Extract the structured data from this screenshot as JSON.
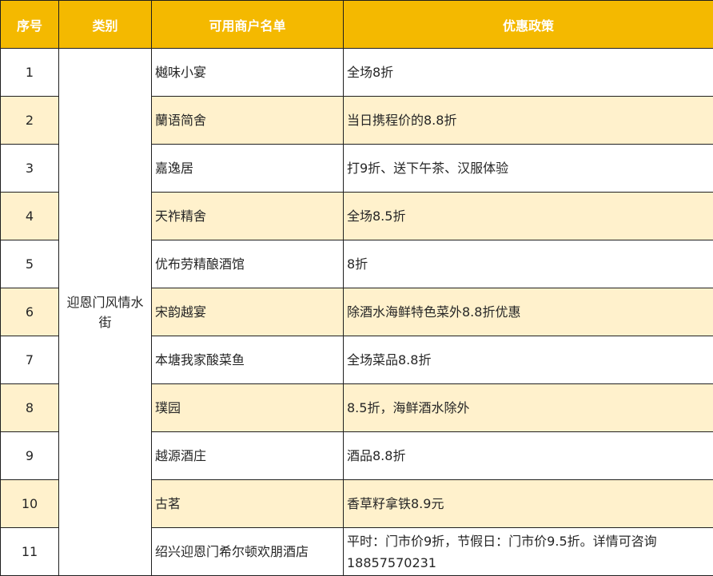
{
  "colors": {
    "header_bg": "#f4b900",
    "header_text": "#ffffff",
    "alt_row_bg": "#fff1cc",
    "row_bg": "#ffffff",
    "border": "#1f1f1f"
  },
  "table": {
    "headers": [
      "序号",
      "类别",
      "可用商户名单",
      "优惠政策"
    ],
    "category": "迎恩门风情水街",
    "rows": [
      {
        "no": "1",
        "merchant": "樾味小宴",
        "policy": "全场8折"
      },
      {
        "no": "2",
        "merchant": "蘭语简舍",
        "policy": "当日携程价的8.8折"
      },
      {
        "no": "3",
        "merchant": "嘉逸居",
        "policy": "打9折、送下午茶、汉服体验"
      },
      {
        "no": "4",
        "merchant": "天祚精舍",
        "policy": "全场8.5折"
      },
      {
        "no": "5",
        "merchant": "优布劳精酿酒馆",
        "policy": "8折"
      },
      {
        "no": "6",
        "merchant": "宋韵越宴",
        "policy": "除酒水海鲜特色菜外8.8折优惠"
      },
      {
        "no": "7",
        "merchant": "本塘我家酸菜鱼",
        "policy": "全场菜品8.8折"
      },
      {
        "no": "8",
        "merchant": "璞园",
        "policy": "8.5折，海鲜酒水除外"
      },
      {
        "no": "9",
        "merchant": "越源酒庄",
        "policy": "酒品8.8折"
      },
      {
        "no": "10",
        "merchant": "古茗",
        "policy": "香草籽拿铁8.9元"
      },
      {
        "no": "11",
        "merchant": "绍兴迎恩门希尔顿欢朋酒店",
        "policy": "平时：门市价9折，节假日：门市价9.5折。详情可咨询18857570231"
      }
    ]
  }
}
